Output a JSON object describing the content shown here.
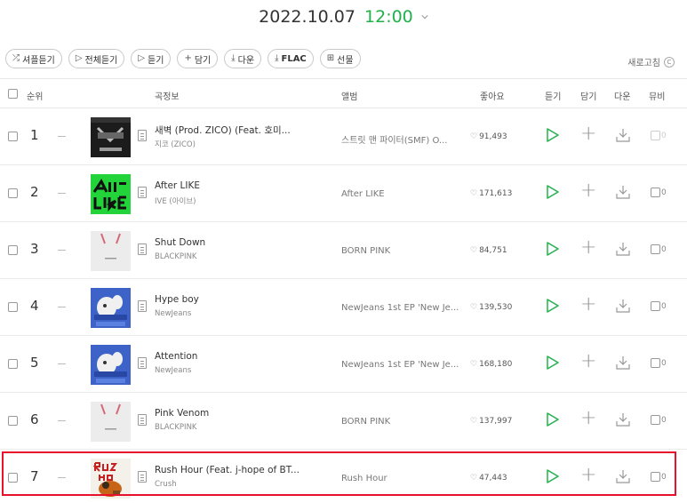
{
  "header": {
    "date": "2022.10.07",
    "time": "12:00"
  },
  "toolbar": {
    "buttons": [
      {
        "label": "셔플듣기",
        "icon": "shuffle-icon",
        "glyph": "⤮"
      },
      {
        "label": "전체듣기",
        "icon": "play-icon",
        "glyph": "▷"
      },
      {
        "label": "듣기",
        "icon": "play-icon",
        "glyph": "▷"
      },
      {
        "label": "담기",
        "icon": "plus-icon",
        "glyph": "+"
      },
      {
        "label": "다운",
        "icon": "download-icon",
        "glyph": "⤓"
      },
      {
        "label": "FLAC",
        "icon": "download-icon",
        "glyph": "⤓"
      },
      {
        "label": "선물",
        "icon": "gift-icon",
        "glyph": "⊞"
      }
    ],
    "refresh_label": "새로고침"
  },
  "table": {
    "headers": {
      "rank": "순위",
      "song_info": "곡정보",
      "album": "앨범",
      "likes": "좋아요",
      "listen": "듣기",
      "add": "담기",
      "download": "다운",
      "mv": "뮤비"
    },
    "rows": [
      {
        "rank": "1",
        "title": "새벽 (Prod. ZICO) (Feat. 호미...",
        "artist": "지코 (ZICO)",
        "album": "스트릿 맨 파이터(SMF) O...",
        "likes": "91,493",
        "mv_count": "0",
        "mv_available": false,
        "cover": "smf"
      },
      {
        "rank": "2",
        "title": "After LIKE",
        "artist": "IVE (아이브)",
        "album": "After LIKE",
        "likes": "171,613",
        "mv_count": "0",
        "mv_available": true,
        "cover": "afterlike"
      },
      {
        "rank": "3",
        "title": "Shut Down",
        "artist": "BLACKPINK",
        "album": "BORN PINK",
        "likes": "84,751",
        "mv_count": "0",
        "mv_available": true,
        "cover": "bornpink"
      },
      {
        "rank": "4",
        "title": "Hype boy",
        "artist": "NewJeans",
        "album": "NewJeans 1st EP 'New Je...",
        "likes": "139,530",
        "mv_count": "0",
        "mv_available": true,
        "cover": "newjeans"
      },
      {
        "rank": "5",
        "title": "Attention",
        "artist": "NewJeans",
        "album": "NewJeans 1st EP 'New Je...",
        "likes": "168,180",
        "mv_count": "0",
        "mv_available": true,
        "cover": "newjeans"
      },
      {
        "rank": "6",
        "title": "Pink Venom",
        "artist": "BLACKPINK",
        "album": "BORN PINK",
        "likes": "137,997",
        "mv_count": "0",
        "mv_available": true,
        "cover": "bornpink"
      },
      {
        "rank": "7",
        "title": "Rush Hour (Feat. j-hope of BT...",
        "artist": "Crush",
        "album": "Rush Hour",
        "likes": "47,443",
        "mv_count": "0",
        "mv_available": true,
        "cover": "rushhour",
        "highlighted": true
      }
    ]
  },
  "colors": {
    "accent_green": "#1fb24a",
    "highlight_red": "#e8102a"
  }
}
